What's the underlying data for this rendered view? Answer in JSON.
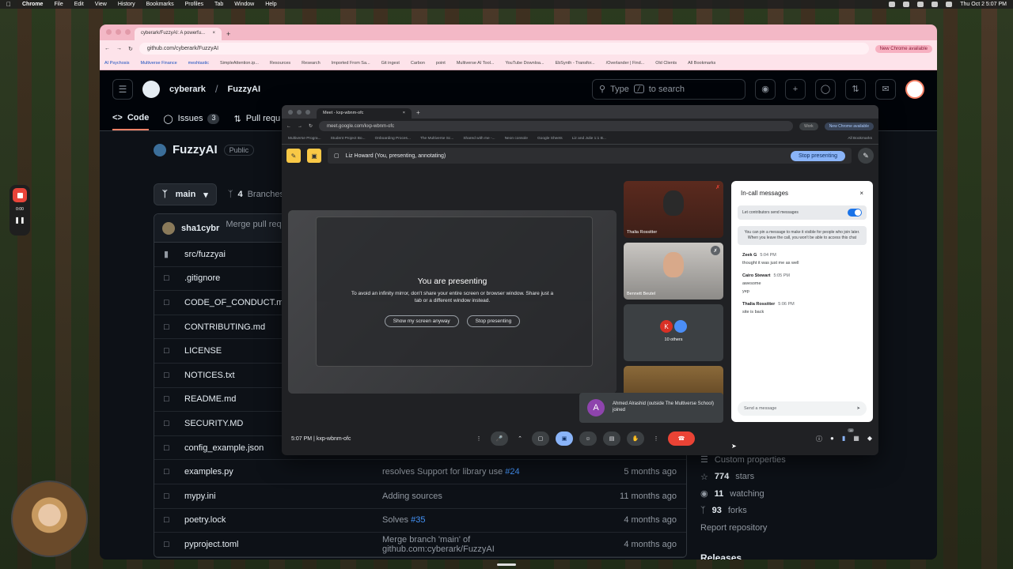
{
  "menubar": {
    "app": "Chrome",
    "items": [
      "File",
      "Edit",
      "View",
      "History",
      "Bookmarks",
      "Profiles",
      "Tab",
      "Window",
      "Help"
    ],
    "clock": "Thu Oct 2  5:07 PM"
  },
  "gh_browser": {
    "tab_title": "cyberark/FuzzyAI: A powerfu...",
    "url": "github.com/cyberark/FuzzyAI",
    "update_label": "New Chrome available",
    "bookmarks": [
      "AI Psychosis",
      "Multiverse Finance",
      "meshtastic",
      "SimpleAttention.ip...",
      "Resources",
      "Research",
      "Imported From Sa...",
      "Git ingest",
      "Carbon",
      "point",
      "Multiverse AI Tool...",
      "YouTube Downloa...",
      "EbSynth - Transfor...",
      "/Overlander | Find...",
      "Old Clients",
      "All Bookmarks"
    ]
  },
  "github": {
    "owner": "cyberark",
    "repo": "FuzzyAI",
    "search_prefix": "Type",
    "search_key": "/",
    "search_suffix": "to search",
    "nav": [
      {
        "label": "Code"
      },
      {
        "label": "Issues",
        "count": "3"
      },
      {
        "label": "Pull requ"
      }
    ],
    "repo_name": "FuzzyAI",
    "visibility": "Public",
    "branch": "main",
    "branches_count": "4",
    "branches_label": "Branches",
    "latest_commit_user": "sha1cybr",
    "latest_commit_msg": "Merge pull requ",
    "files": [
      {
        "icon": "folder",
        "name": "src/fuzzyai",
        "msg": "",
        "link": "",
        "time": ""
      },
      {
        "icon": "file",
        "name": ".gitignore",
        "msg": "",
        "link": "",
        "time": ""
      },
      {
        "icon": "file",
        "name": "CODE_OF_CONDUCT.md",
        "msg": "",
        "link": "",
        "time": ""
      },
      {
        "icon": "file",
        "name": "CONTRIBUTING.md",
        "msg": "",
        "link": "",
        "time": ""
      },
      {
        "icon": "file",
        "name": "LICENSE",
        "msg": "",
        "link": "",
        "time": ""
      },
      {
        "icon": "file",
        "name": "NOTICES.txt",
        "msg": "",
        "link": "",
        "time": ""
      },
      {
        "icon": "file",
        "name": "README.md",
        "msg": "",
        "link": "",
        "time": ""
      },
      {
        "icon": "file",
        "name": "SECURITY.MD",
        "msg": "",
        "link": "",
        "time": ""
      },
      {
        "icon": "file",
        "name": "config_example.json",
        "msg": "",
        "link": "",
        "time": ""
      },
      {
        "icon": "file",
        "name": "examples.py",
        "msg": "resolves Support for library use ",
        "link": "#24",
        "time": "5 months ago"
      },
      {
        "icon": "file",
        "name": "mypy.ini",
        "msg": "Adding sources",
        "link": "",
        "time": "11 months ago"
      },
      {
        "icon": "file",
        "name": "poetry.lock",
        "msg": "Solves ",
        "link": "#35",
        "time": "4 months ago"
      },
      {
        "icon": "file",
        "name": "pyproject.toml",
        "msg": "Merge branch 'main' of github.com:cyberark/FuzzyAI",
        "link": "",
        "time": "4 months ago"
      }
    ],
    "sidebar": {
      "custom": "Custom properties",
      "stars": "774",
      "stars_label": "stars",
      "watching": "11",
      "watching_label": "watching",
      "forks": "93",
      "forks_label": "forks",
      "report": "Report repository",
      "releases": "Releases"
    }
  },
  "meet_browser": {
    "tab_title": "Meet - kxp-wbnm-ofc",
    "url": "meet.google.com/kxp-wbnm-ofc",
    "work": "Work",
    "update_label": "New Chrome available",
    "bookmarks": [
      "Multiverse Progra...",
      "Student Project Bo...",
      "Onboarding Proces...",
      "The Multiverse Sc...",
      "Shared with me -...",
      "Neon console",
      "Google Sheets",
      "Liz and Julie 1:1 B...",
      "All Bookmarks"
    ]
  },
  "meet": {
    "presenting_bar": "Liz Howard (You, presenting, annotating)",
    "stop_label": "Stop presenting",
    "stage_title": "You are presenting",
    "stage_text": "To avoid an infinity mirror, don't share your entire screen or browser window. Share just a tab or a different window instead.",
    "show_anyway": "Show my screen anyway",
    "stop_presenting": "Stop presenting",
    "tiles": [
      {
        "name": "Thalia Rossitter"
      },
      {
        "name": "Bennett Beutel"
      },
      {
        "name": "10 others"
      }
    ],
    "others_initial": "K",
    "toast_initial": "A",
    "toast_text": "Ahmed Alrashid (outside The Multiverse School) joined",
    "time": "5:07 PM",
    "sep": "|",
    "code": "kxp-wbnm-ofc",
    "people_count": "14",
    "chat": {
      "title": "In-call messages",
      "toggle_label": "Let contributors send messages",
      "note": "You can pin a message to make it visible for people who join later. When you leave the call, you won't be able to access this chat",
      "messages": [
        {
          "who": "Zeek G",
          "time": "5:04 PM",
          "lines": [
            "thought it was just me as well"
          ]
        },
        {
          "who": "Cairo Stewart",
          "time": "5:05 PM",
          "lines": [
            "awesome",
            "yep"
          ]
        },
        {
          "who": "Thalia Rossitter",
          "time": "5:06 PM",
          "lines": [
            "site is back"
          ]
        }
      ],
      "input_placeholder": "Send a message"
    }
  },
  "recorder": {
    "time": "0:00"
  }
}
